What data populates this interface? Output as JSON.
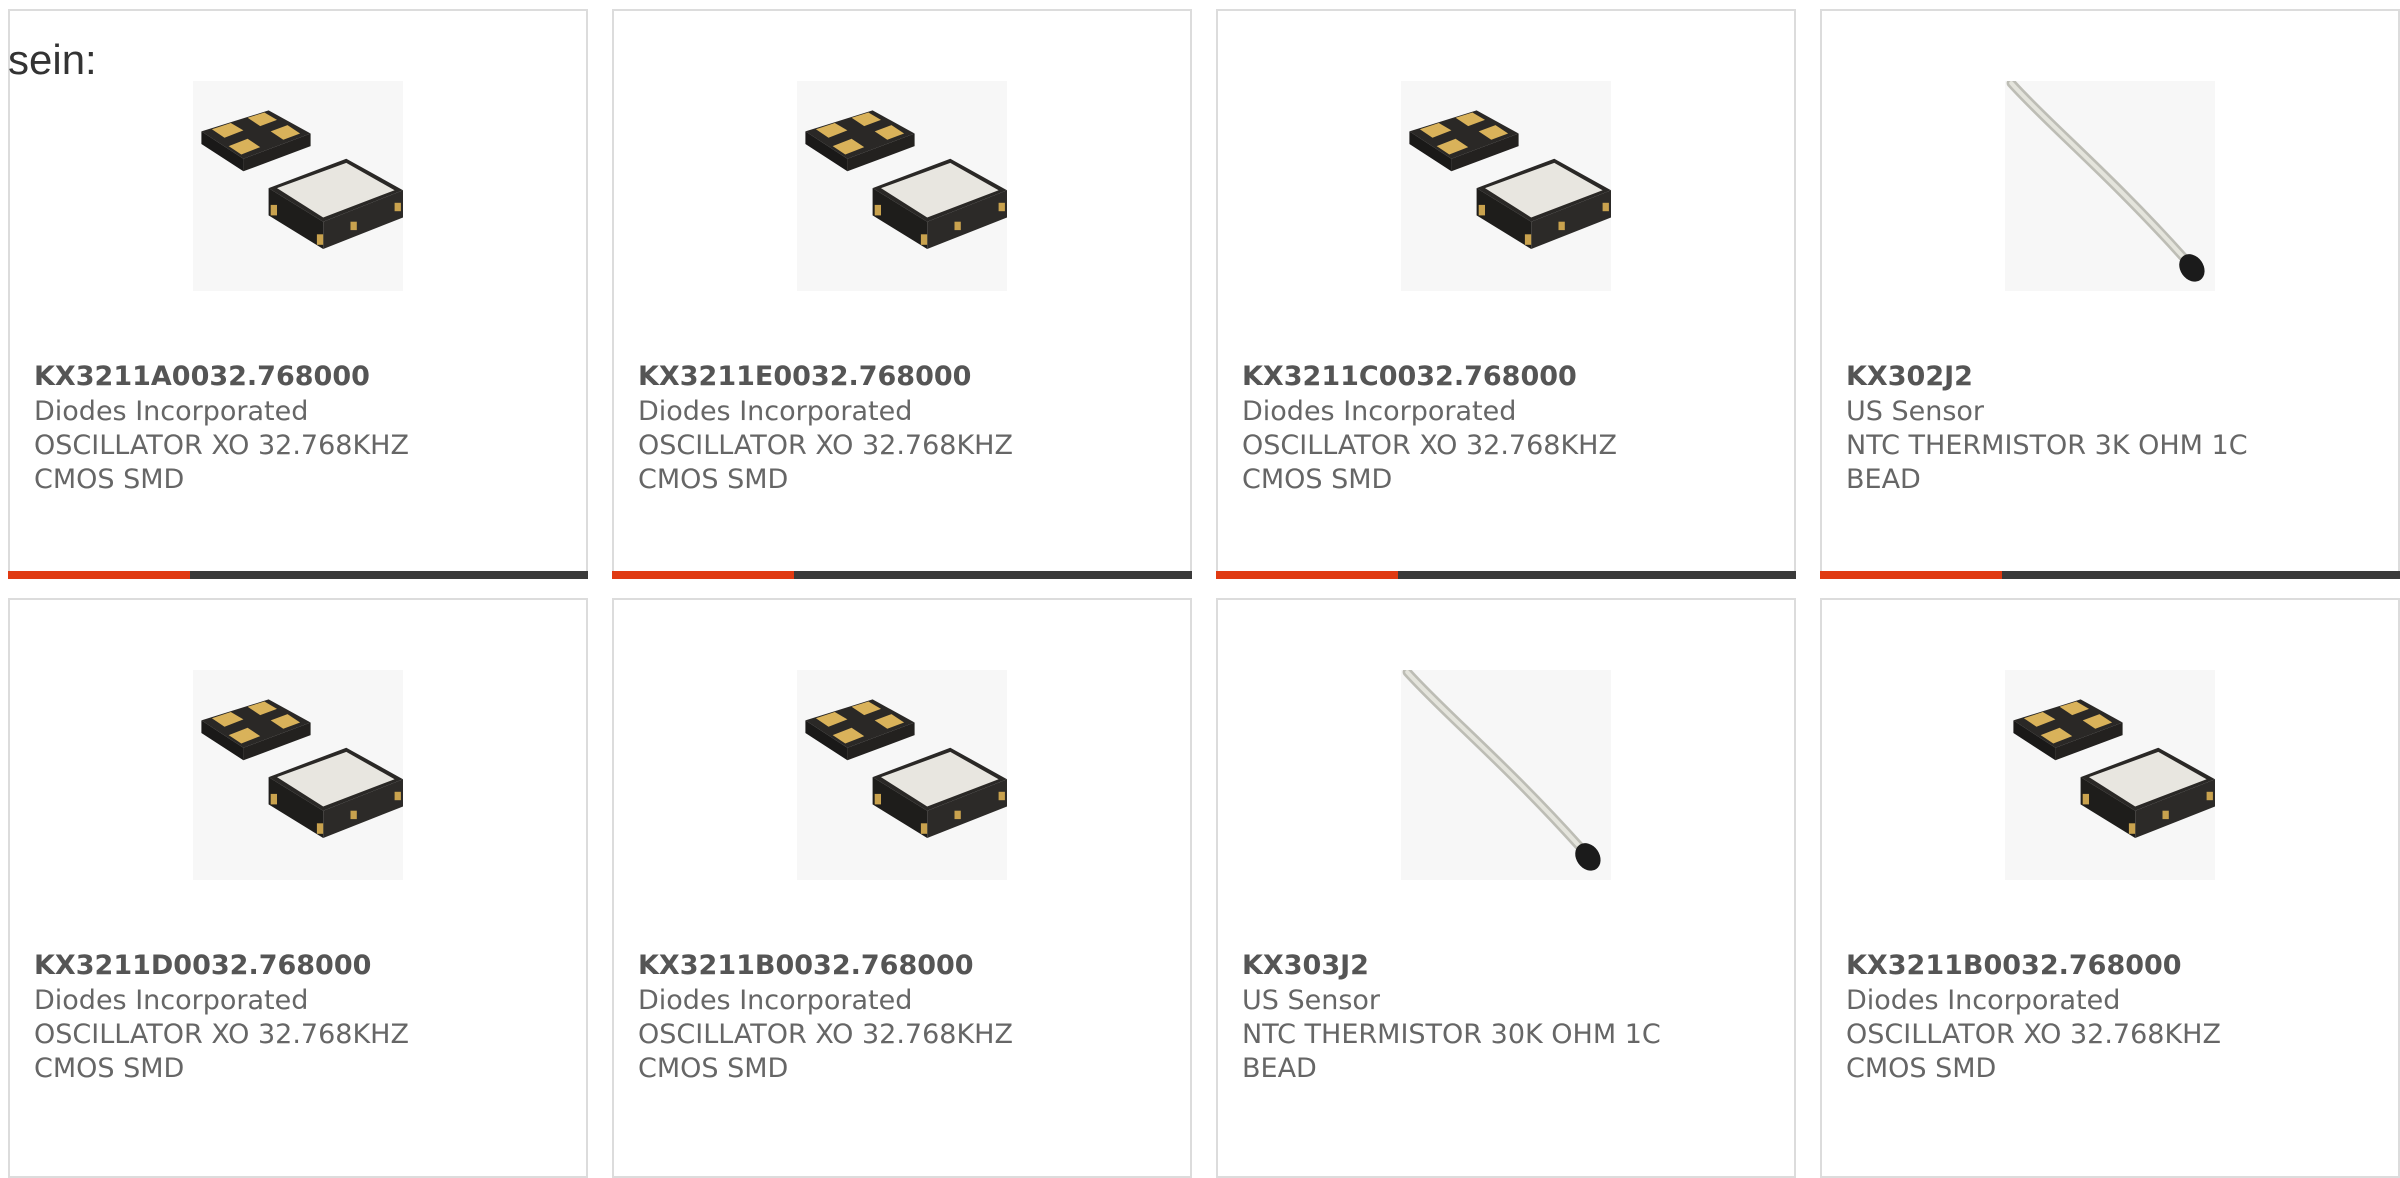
{
  "intro_text": "sein:",
  "colors": {
    "accent": "#e03a12",
    "bar": "#3a3a3a",
    "border": "#dcdcdc"
  },
  "products": [
    {
      "part": "KX3211A0032.768000",
      "manufacturer": "Diodes Incorporated",
      "description": "OSCILLATOR XO 32.768KHZ CMOS SMD",
      "image": "oscillator-chip"
    },
    {
      "part": "KX3211E0032.768000",
      "manufacturer": "Diodes Incorporated",
      "description": "OSCILLATOR XO 32.768KHZ CMOS SMD",
      "image": "oscillator-chip"
    },
    {
      "part": "KX3211C0032.768000",
      "manufacturer": "Diodes Incorporated",
      "description": "OSCILLATOR XO 32.768KHZ CMOS SMD",
      "image": "oscillator-chip"
    },
    {
      "part": "KX302J2",
      "manufacturer": "US Sensor",
      "description": "NTC THERMISTOR 3K OHM 1C BEAD",
      "image": "thermistor-bead"
    },
    {
      "part": "KX3211D0032.768000",
      "manufacturer": "Diodes Incorporated",
      "description": "OSCILLATOR XO 32.768KHZ CMOS SMD",
      "image": "oscillator-chip"
    },
    {
      "part": "KX3211B0032.768000",
      "manufacturer": "Diodes Incorporated",
      "description": "OSCILLATOR XO 32.768KHZ CMOS SMD",
      "image": "oscillator-chip"
    },
    {
      "part": "KX303J2",
      "manufacturer": "US Sensor",
      "description": "NTC THERMISTOR 30K OHM 1C BEAD",
      "image": "thermistor-bead"
    },
    {
      "part": "KX3211B0032.768000",
      "manufacturer": "Diodes Incorporated",
      "description": "OSCILLATOR XO 32.768KHZ CMOS SMD",
      "image": "oscillator-chip"
    }
  ]
}
